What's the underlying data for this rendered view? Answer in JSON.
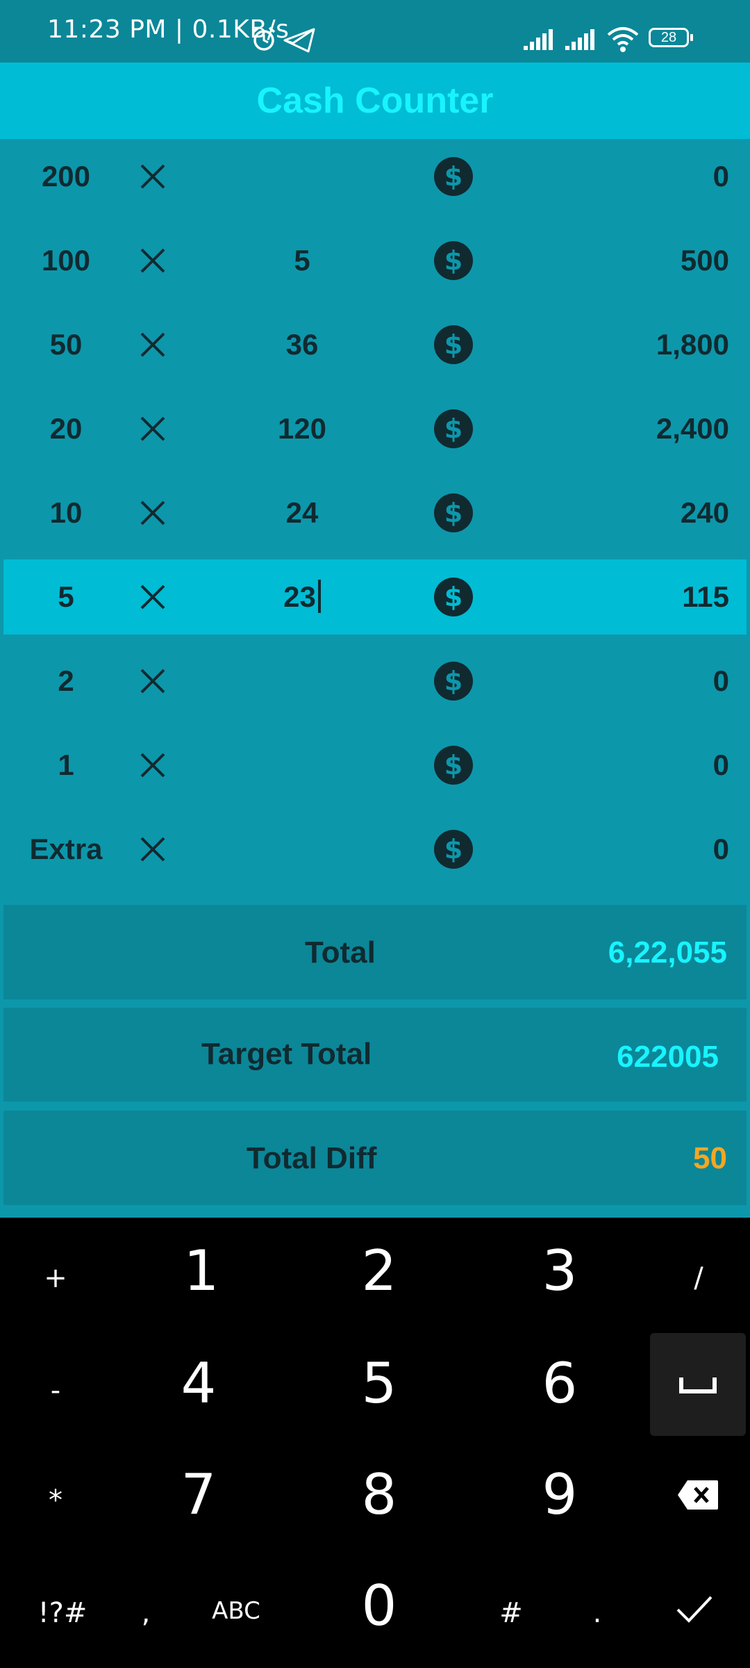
{
  "status_bar": {
    "time": "11:23 PM | 0.1KB/s",
    "battery": "28"
  },
  "app_bar": {
    "title": "Cash Counter"
  },
  "rows": [
    {
      "denomination": "200",
      "count": "",
      "amount": "0"
    },
    {
      "denomination": "100",
      "count": "5",
      "amount": "500"
    },
    {
      "denomination": "50",
      "count": "36",
      "amount": "1,800"
    },
    {
      "denomination": "20",
      "count": "120",
      "amount": "2,400"
    },
    {
      "denomination": "10",
      "count": "24",
      "amount": "240"
    },
    {
      "denomination": "5",
      "count": "23",
      "amount": "115"
    },
    {
      "denomination": "2",
      "count": "",
      "amount": "0"
    },
    {
      "denomination": "1",
      "count": "",
      "amount": "0"
    },
    {
      "denomination": "Extra",
      "count": "",
      "amount": "0"
    }
  ],
  "totals": {
    "total_label": "Total",
    "total_value": "6,22,055",
    "target_label": "Target Total",
    "target_value": "622005",
    "diff_label": "Total Diff",
    "diff_value": "50"
  },
  "keyboard": {
    "plus": "+",
    "k1": "1",
    "k2": "2",
    "k3": "3",
    "slash": "/",
    "minus": "-",
    "k4": "4",
    "k5": "5",
    "k6": "6",
    "star": "*",
    "k7": "7",
    "k8": "8",
    "k9": "9",
    "symbols": "!?#",
    "comma": ",",
    "abc": "ABC",
    "k0": "0",
    "hash": "#",
    "dot": "."
  },
  "colors": {
    "background": "#0d97ab",
    "app_bar": "#00bcd4",
    "title": "#18f4ff",
    "total_value": "#18f4ff",
    "diff_value": "#f5a623",
    "keyboard": "#000000"
  },
  "icons": {
    "multiply": "times-icon",
    "currency": "dollar-coin-icon",
    "backspace": "backspace-icon",
    "space": "space-icon",
    "done": "check-icon"
  }
}
